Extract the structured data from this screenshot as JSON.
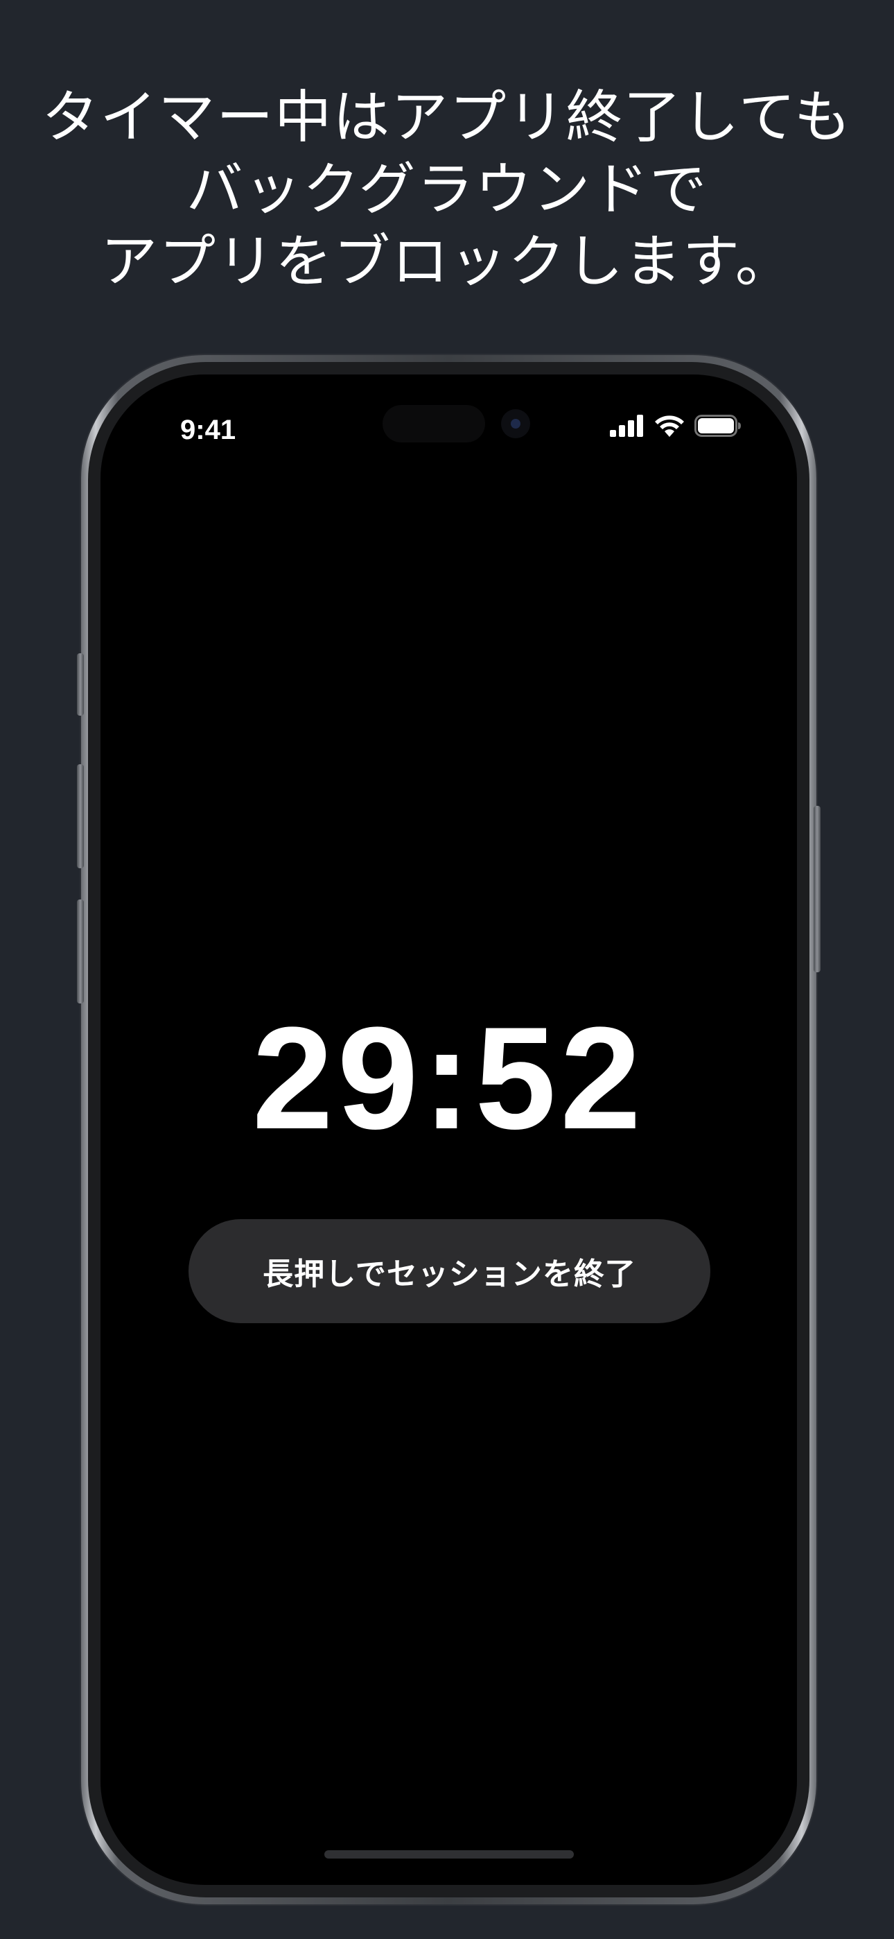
{
  "promo": {
    "line1": "タイマー中はアプリ終了しても",
    "line2": "バックグラウンドで",
    "line3": "アプリをブロックします。"
  },
  "status_bar": {
    "time": "9:41",
    "icons": [
      "signal-icon",
      "wifi-icon",
      "battery-icon"
    ]
  },
  "timer": {
    "value": "29:52"
  },
  "end_session_button": {
    "label": "長押しでセッションを終了"
  },
  "colors": {
    "background": "#22262d",
    "screen": "#000000",
    "button": "#2c2c2e",
    "text": "#ffffff"
  }
}
